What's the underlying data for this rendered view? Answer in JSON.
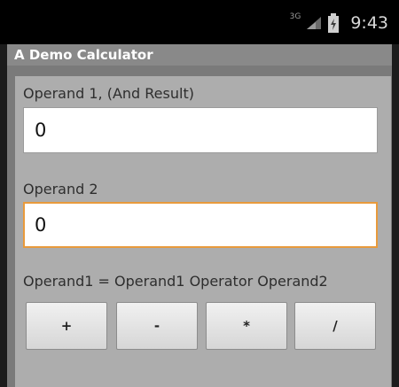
{
  "status_bar": {
    "network": "3G",
    "time": "9:43",
    "icons": [
      "signal-icon",
      "battery-icon"
    ]
  },
  "app": {
    "title": "A Demo Calculator"
  },
  "form": {
    "operand1_label": "Operand 1, (And Result)",
    "operand1_value": "0",
    "operand2_label": "Operand 2",
    "operand2_value": "0",
    "formula": "Operand1 = Operand1 Operator Operand2"
  },
  "operators": [
    {
      "label": "+"
    },
    {
      "label": "-"
    },
    {
      "label": "*"
    },
    {
      "label": "/"
    }
  ],
  "colors": {
    "focus_border": "#e89a3c",
    "title_bar": "#898989",
    "panel": "#adadad"
  }
}
